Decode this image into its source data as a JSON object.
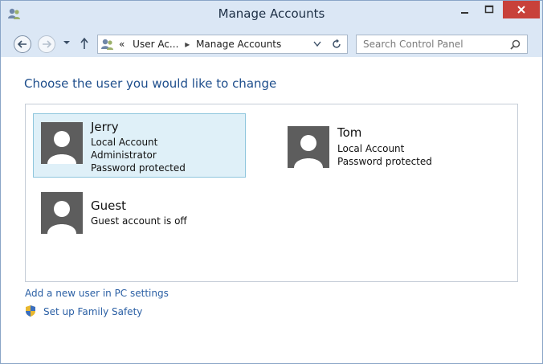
{
  "window": {
    "title": "Manage Accounts"
  },
  "address": {
    "overflow": "«",
    "crumbs": [
      "User Ac...",
      "Manage Accounts"
    ]
  },
  "search": {
    "placeholder": "Search Control Panel"
  },
  "heading": "Choose the user you would like to change",
  "accounts": [
    {
      "name": "Jerry",
      "lines": [
        "Local Account",
        "Administrator",
        "Password protected"
      ],
      "selected": true
    },
    {
      "name": "Tom",
      "lines": [
        "Local Account",
        "Password protected"
      ],
      "selected": false
    },
    {
      "name": "Guest",
      "lines": [
        "Guest account is off"
      ],
      "selected": false
    }
  ],
  "links": {
    "add_user": "Add a new user in PC settings",
    "family_safety": "Set up Family Safety"
  },
  "colors": {
    "accent_link": "#2a5fa4",
    "heading": "#1e4e8c",
    "selection": "#dff0f8",
    "close": "#c8413a"
  }
}
